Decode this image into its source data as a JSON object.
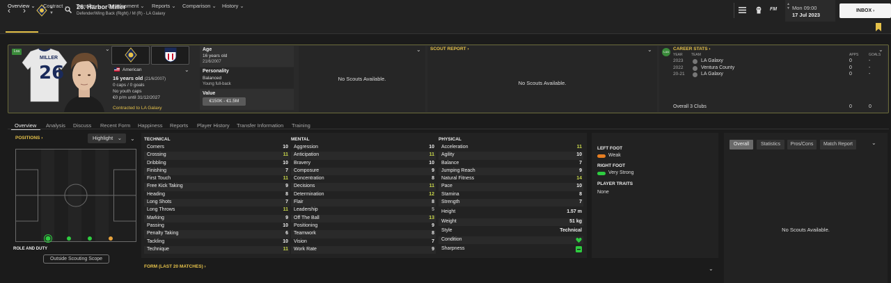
{
  "header": {
    "title": "26. Harbor Miller",
    "subtitle": "Defender/Wing Back (Right) / M (R) - LA Galaxy",
    "day_time": "Mon 09:00",
    "date": "17 Jul 2023",
    "inbox_label": "INBOX",
    "fm_label": "FM"
  },
  "menu": [
    "Overview",
    "Contract",
    "Transfer",
    "Development",
    "Reports",
    "Comparison",
    "History"
  ],
  "player": {
    "shirt_name": "MILLER",
    "shirt_number": "26",
    "status_tag": "Loa",
    "nationality": "American",
    "age_line": "16 years old",
    "dob_short": "(21/6/2007)",
    "caps": "0 caps / 0 goals",
    "youth_caps": "No youth caps",
    "contract": "€0 p/m until 31/12/2027",
    "contracted_to": "Contracted to LA Galaxy"
  },
  "info": {
    "age_label": "Age",
    "age_value": "16 years old",
    "dob": "21/6/2007",
    "personality_label": "Personality",
    "personality_value": "Balanced",
    "personality_note": "Young full-back",
    "value_label": "Value",
    "value_range": "€150K - €1.5M"
  },
  "scouts": {
    "none_1": "No Scouts Available.",
    "report_title": "SCOUT REPORT",
    "none_2": "No Scouts Available."
  },
  "career": {
    "title": "CAREER STATS",
    "col_year": "YEAR",
    "col_team": "TEAM",
    "col_apps": "APPS",
    "col_goals": "GOALS",
    "rows": [
      {
        "year": "2023",
        "team": "LA Galaxy",
        "apps": "0",
        "goals": "-"
      },
      {
        "year": "2022",
        "team": "Ventura County",
        "apps": "0",
        "goals": "-"
      },
      {
        "year": "20-21",
        "team": "LA Galaxy",
        "apps": "0",
        "goals": "-"
      }
    ],
    "overall_label": "Overall 3 Clubs",
    "overall_apps": "0",
    "overall_goals": "0"
  },
  "subtabs": [
    "Overview",
    "Analysis",
    "Discuss",
    "Recent Form",
    "Happiness",
    "Reports",
    "Player History",
    "Transfer Information",
    "Training"
  ],
  "positions": {
    "title": "POSITIONS",
    "highlight_label": "Highlight",
    "role_duty": "ROLE AND DUTY",
    "outside_scope": "Outside Scouting Scope",
    "markers": [
      {
        "name": "DR",
        "color": "#2ecc40",
        "ring": true
      },
      {
        "name": "DC",
        "color": "#2ecc40",
        "ring": false
      },
      {
        "name": "DC2",
        "color": "#2ecc40",
        "ring": false
      },
      {
        "name": "DL",
        "color": "#e6a23c",
        "ring": false
      }
    ]
  },
  "technical": {
    "title": "TECHNICAL",
    "attrs": [
      {
        "name": "Corners",
        "value": "10",
        "color": "#eeeeee"
      },
      {
        "name": "Crossing",
        "value": "11",
        "color": "#c8d64a"
      },
      {
        "name": "Dribbling",
        "value": "10",
        "color": "#eeeeee"
      },
      {
        "name": "Finishing",
        "value": "7",
        "color": "#eeeeee"
      },
      {
        "name": "First Touch",
        "value": "11",
        "color": "#c8d64a"
      },
      {
        "name": "Free Kick Taking",
        "value": "9",
        "color": "#eeeeee"
      },
      {
        "name": "Heading",
        "value": "8",
        "color": "#eeeeee"
      },
      {
        "name": "Long Shots",
        "value": "7",
        "color": "#eeeeee"
      },
      {
        "name": "Long Throws",
        "value": "11",
        "color": "#c8d64a"
      },
      {
        "name": "Marking",
        "value": "9",
        "color": "#eeeeee"
      },
      {
        "name": "Passing",
        "value": "10",
        "color": "#eeeeee"
      },
      {
        "name": "Penalty Taking",
        "value": "6",
        "color": "#eeeeee"
      },
      {
        "name": "Tackling",
        "value": "10",
        "color": "#eeeeee"
      },
      {
        "name": "Technique",
        "value": "11",
        "color": "#c8d64a"
      }
    ]
  },
  "mental": {
    "title": "MENTAL",
    "attrs": [
      {
        "name": "Aggression",
        "value": "10",
        "color": "#eeeeee"
      },
      {
        "name": "Anticipation",
        "value": "11",
        "color": "#c8d64a"
      },
      {
        "name": "Bravery",
        "value": "10",
        "color": "#eeeeee"
      },
      {
        "name": "Composure",
        "value": "9",
        "color": "#eeeeee"
      },
      {
        "name": "Concentration",
        "value": "8",
        "color": "#eeeeee"
      },
      {
        "name": "Decisions",
        "value": "11",
        "color": "#c8d64a"
      },
      {
        "name": "Determination",
        "value": "12",
        "color": "#c8d64a"
      },
      {
        "name": "Flair",
        "value": "8",
        "color": "#eeeeee"
      },
      {
        "name": "Leadership",
        "value": "5",
        "color": "#aaaaaa"
      },
      {
        "name": "Off The Ball",
        "value": "13",
        "color": "#c8d64a"
      },
      {
        "name": "Positioning",
        "value": "9",
        "color": "#eeeeee"
      },
      {
        "name": "Teamwork",
        "value": "8",
        "color": "#eeeeee"
      },
      {
        "name": "Vision",
        "value": "7",
        "color": "#eeeeee"
      },
      {
        "name": "Work Rate",
        "value": "9",
        "color": "#eeeeee"
      }
    ]
  },
  "physical": {
    "title": "PHYSICAL",
    "attrs": [
      {
        "name": "Acceleration",
        "value": "11",
        "color": "#c8d64a"
      },
      {
        "name": "Agility",
        "value": "10",
        "color": "#eeeeee"
      },
      {
        "name": "Balance",
        "value": "7",
        "color": "#eeeeee"
      },
      {
        "name": "Jumping Reach",
        "value": "9",
        "color": "#eeeeee"
      },
      {
        "name": "Natural Fitness",
        "value": "14",
        "color": "#c8d64a"
      },
      {
        "name": "Pace",
        "value": "10",
        "color": "#eeeeee"
      },
      {
        "name": "Stamina",
        "value": "8",
        "color": "#eeeeee"
      },
      {
        "name": "Strength",
        "value": "7",
        "color": "#eeeeee"
      }
    ],
    "height_label": "Height",
    "height_value": "1.57 m",
    "weight_label": "Weight",
    "weight_value": "51 kg",
    "style_label": "Style",
    "style_value": "Technical",
    "condition_label": "Condition",
    "sharpness_label": "Sharpness"
  },
  "feet": {
    "left_title": "LEFT FOOT",
    "left_value": "Weak",
    "right_title": "RIGHT FOOT",
    "right_value": "Very Strong",
    "traits_title": "PLAYER TRAITS",
    "traits_value": "None"
  },
  "form_title": "FORM (LAST 20 MATCHES)",
  "right_panel": {
    "tabs": [
      "Overall",
      "Statistics",
      "Pros/Cons",
      "Match Report"
    ],
    "none": "No Scouts Available."
  },
  "colors": {
    "accent": "#e6c24a",
    "good": "#2ecc40",
    "highlight": "#c8d64a"
  }
}
